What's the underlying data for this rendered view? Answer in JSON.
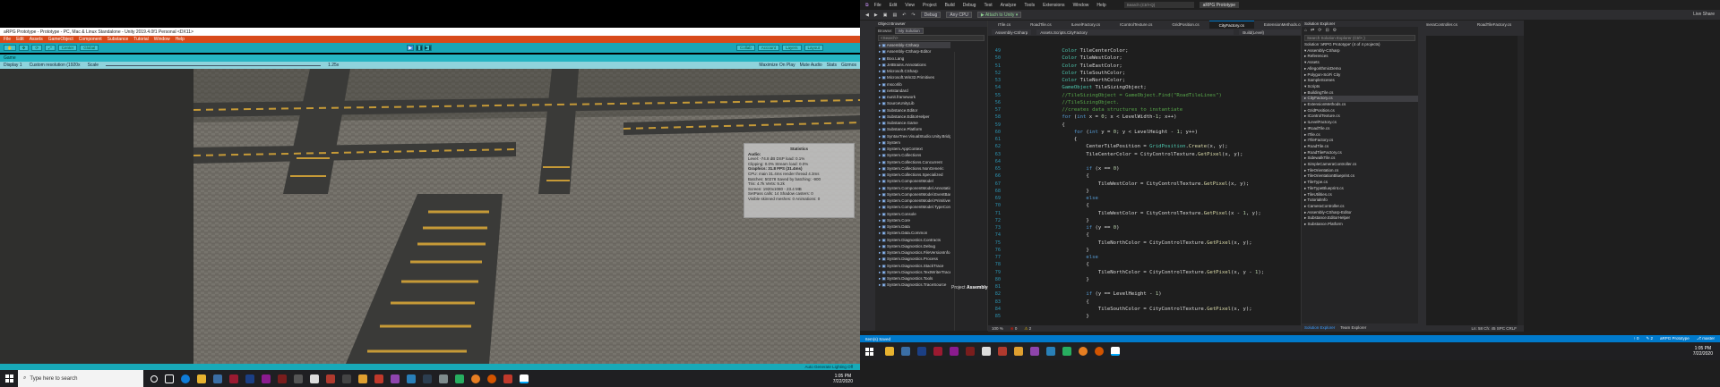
{
  "unity": {
    "title": "aRPG Prototype - Prototype - PC, Mac & Linux Standalone - Unity 2019.4.0f1 Personal <DX11>",
    "menu": [
      "File",
      "Edit",
      "Assets",
      "GameObject",
      "Component",
      "Substance",
      "Tutorial",
      "Window",
      "Help"
    ],
    "toolbar_left": [
      "Center",
      "Global"
    ],
    "toolbar_right": [
      "Collab",
      "Account",
      "Layers",
      "Layout"
    ],
    "play_buttons": [
      "▶",
      "❚❚",
      "▶❚"
    ],
    "game_tab": "Game",
    "gamebar": {
      "display": "Display 1",
      "resolution": "Custom resolution (1920x",
      "scale_label": "Scale",
      "scale_value": "1.25x",
      "right": [
        "Maximize On Play",
        "Mute Audio",
        "Stats",
        "Gizmos"
      ]
    },
    "status": "Auto Generate Lighting Off",
    "stats": {
      "header": "Statistics",
      "lines": [
        "Audio:",
        "Level: -74.8 dB          DSP load: 0.1%",
        "Clipping: 0.0%           Stream load: 0.0%",
        "Graphics:                31.8 FPS (31.4ms)",
        "CPU: main 31.4ms  render thread 4.3ms",
        "Batches: 50278    Saved by batching: -900",
        "Tris: 4.7k          Verts: 9.2k",
        "Screen: 1920x1080 - 23.4 MB",
        "SetPass calls: 14      Shadow casters: 0",
        "Visible skinned meshes: 0  Animations: 0"
      ]
    }
  },
  "taskbar_left": {
    "search_placeholder": "Type here to search",
    "time": "1:05 PM",
    "date": "7/22/2020"
  },
  "vs": {
    "menu": [
      "File",
      "Edit",
      "View",
      "Project",
      "Build",
      "Debug",
      "Test",
      "Analyze",
      "Tools",
      "Extensions",
      "Window",
      "Help"
    ],
    "search": "Search (Ctrl+Q)",
    "project": "aRPG Prototype",
    "toolbar": {
      "config": "Debug",
      "platform": "Any CPU",
      "attach": "▶ Attach to Unity ▾"
    },
    "live_share": "Live Share",
    "object_browser": {
      "header": "Object Browser",
      "browse_label": "Browse:",
      "browse_value": "My Solution",
      "search": "<Search>",
      "items": [
        "Assembly-CSharp",
        "Assembly-CSharp-Editor",
        "Boo.Lang",
        "JetBrains.Annotations",
        "Microsoft.CSharp",
        "Microsoft.Win32.Primitives",
        "mscorlib",
        "netstandard",
        "nunit.framework",
        "SourceUnityLib",
        "Substance.Editor",
        "Substance.EditorHelper",
        "Substance.Game",
        "Substance.Platform",
        "SyntaxTree.VisualStudio.Unity.Bridge",
        "System",
        "System.AppContext",
        "System.Collections",
        "System.Collections.Concurrent",
        "System.Collections.NonGeneric",
        "System.Collections.Specialized",
        "System.ComponentModel",
        "System.ComponentModel.Annotations",
        "System.ComponentModel.EventBasedAsync",
        "System.ComponentModel.Primitives",
        "System.ComponentModel.TypeConverter",
        "System.Console",
        "System.Core",
        "System.Data",
        "System.Data.Common",
        "System.Diagnostics.Contracts",
        "System.Diagnostics.Debug",
        "System.Diagnostics.FileVersionInfo",
        "System.Diagnostics.Process",
        "System.Diagnostics.StackTrace",
        "System.Diagnostics.TextWriterTraceListener",
        "System.Diagnostics.Tools",
        "System.Diagnostics.TraceSource"
      ],
      "project_label": "Project",
      "project_name": "Assembly-CSharp"
    },
    "tabs": [
      "ITile.cs",
      "RoadTile.cs",
      "ILevelFactory.cs",
      "IControlTexture.cs",
      "GridPosition.cs",
      "CityFactory.cs",
      "ExtensionMethods.cs",
      "BuildingTile.cs",
      "RoadTile.cs",
      "SimpleCameraController.cs",
      "RoadTileFactory.cs"
    ],
    "active_tab_index": 5,
    "navbar": [
      "Assembly-CSharp",
      "Assets.Scripts.CityFactory",
      "Build(Level)"
    ],
    "code_lines": [
      {
        "n": "49",
        "t": "            Color TileCenterColor;"
      },
      {
        "n": "50",
        "t": "            Color TileWestColor;"
      },
      {
        "n": "51",
        "t": "            Color TileEastColor;"
      },
      {
        "n": "52",
        "t": "            Color TileSouthColor;"
      },
      {
        "n": "53",
        "t": "            Color TileNorthColor;"
      },
      {
        "n": "54",
        "t": "            GameObject TileSizingObject;"
      },
      {
        "n": "55",
        "t": "            //TileSizingObject = GameObject.Find(\"RoadTileLines\")"
      },
      {
        "n": "56",
        "t": "            //TileSizingObject."
      },
      {
        "n": "57",
        "t": "            //creates data structures to instantiate"
      },
      {
        "n": "58",
        "t": "            for (int x = 0; x < LevelWidth-1; x++)"
      },
      {
        "n": "59",
        "t": "            {"
      },
      {
        "n": "60",
        "t": "                for (int y = 0; y < LevelHeight - 1; y++)"
      },
      {
        "n": "61",
        "t": "                {"
      },
      {
        "n": "62",
        "t": "                    CenterTilePosition = GridPosition.Create(x, y);"
      },
      {
        "n": "63",
        "t": "                    TileCenterColor = CityControlTexture.GetPixel(x, y);"
      },
      {
        "n": "64",
        "t": ""
      },
      {
        "n": "65",
        "t": "                    if (x == 0)"
      },
      {
        "n": "66",
        "t": "                    {"
      },
      {
        "n": "67",
        "t": "                        TileWestColor = CityControlTexture.GetPixel(x, y);"
      },
      {
        "n": "68",
        "t": "                    }"
      },
      {
        "n": "69",
        "t": "                    else"
      },
      {
        "n": "70",
        "t": "                    {"
      },
      {
        "n": "71",
        "t": "                        TileWestColor = CityControlTexture.GetPixel(x - 1, y);"
      },
      {
        "n": "72",
        "t": "                    }"
      },
      {
        "n": "73",
        "t": "                    if (y == 0)"
      },
      {
        "n": "74",
        "t": "                    {"
      },
      {
        "n": "75",
        "t": "                        TileNorthColor = CityControlTexture.GetPixel(x, y);"
      },
      {
        "n": "76",
        "t": "                    }"
      },
      {
        "n": "77",
        "t": "                    else"
      },
      {
        "n": "78",
        "t": "                    {"
      },
      {
        "n": "79",
        "t": "                        TileNorthColor = CityControlTexture.GetPixel(x, y - 1);"
      },
      {
        "n": "80",
        "t": "                    }"
      },
      {
        "n": "81",
        "t": ""
      },
      {
        "n": "82",
        "t": "                    if (y == LevelHeight - 1)"
      },
      {
        "n": "83",
        "t": "                    {"
      },
      {
        "n": "84",
        "t": "                        TileSouthColor = CityControlTexture.GetPixel(x, y);"
      },
      {
        "n": "85",
        "t": "                    }"
      }
    ],
    "editor_status": {
      "zoom": "100 %",
      "errors": "0",
      "warnings": "2",
      "pos": "Ln: 58   Ch: 45   SPC   CRLF"
    },
    "solution_explorer": {
      "header": "Solution Explorer",
      "search": "Search Solution Explorer (Ctrl+;)",
      "items": [
        "Solution 'aRPG Prototype' (4 of 4 projects)",
        "▾ Assembly-CSharp",
        "  ▸ References",
        "  ▾ Assets",
        "    ▸ AllegorithmicDemo",
        "    ▸ Polygon-SciFi City",
        "    ▸ SampleScenes",
        "    ▾ Scripts",
        "      ▸ BuildingTile.cs",
        "      ▸ CityFactory.cs",
        "      ▸ ExtensionMethods.cs",
        "      ▸ GridPosition.cs",
        "      ▸ IControlTexture.cs",
        "      ▸ ILevelFactory.cs",
        "      ▸ IRoadTile.cs",
        "      ▸ ITile.cs",
        "      ▸ ITileFactory.cs",
        "      ▸ RoadTile.cs",
        "      ▸ RoadTileFactory.cs",
        "      ▸ SidewalkTile.cs",
        "      ▸ SimpleCameraController.cs",
        "      ▸ TileOrientation.cs",
        "      ▸ TileOrientationBlueprint.cs",
        "      ▸ TileType.cs",
        "      ▸ TileTypeBlueprint.cs",
        "      ▸ TileUtilities.cs",
        "    ▸ TutorialInfo",
        "    ▸ CameraController.cs",
        "▸ Assembly-CSharp-Editor",
        "▸ Substance.EditorHelper",
        "▸ Substance.Platform"
      ],
      "selected_index": 9,
      "bottom_tabs": [
        "Solution Explorer",
        "Team Explorer"
      ]
    },
    "statusbar": {
      "left": "Item(s) Saved",
      "right": [
        "↑ 0",
        "✎ 2",
        "aRPG Prototype",
        "⎇ master"
      ]
    }
  },
  "taskbar_right": {
    "time": "1:05 PM",
    "date": "7/22/2020"
  },
  "colors": {
    "unity_orange": "#d84a1b",
    "unity_teal": "#1aa6b7",
    "vs_blue": "#007acc"
  }
}
